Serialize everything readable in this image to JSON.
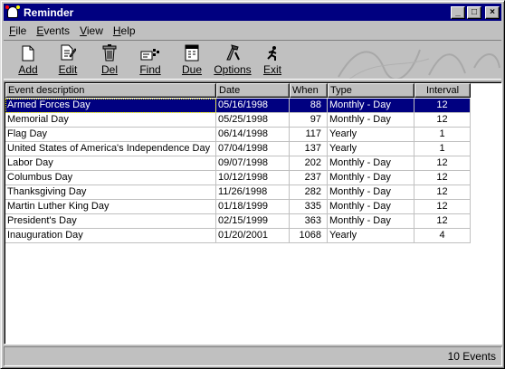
{
  "window": {
    "title": "Reminder",
    "controls": {
      "minimize": "_",
      "maximize": "□",
      "close": "×"
    }
  },
  "menu": [
    {
      "key": "F",
      "rest": "ile"
    },
    {
      "key": "E",
      "rest": "vents"
    },
    {
      "key": "V",
      "rest": "iew"
    },
    {
      "key": "H",
      "rest": "elp"
    }
  ],
  "toolbar": [
    {
      "label": "Add",
      "icon": "new-document-icon"
    },
    {
      "label": "Edit",
      "icon": "edit-document-icon"
    },
    {
      "label": "Del",
      "icon": "trash-can-icon"
    },
    {
      "label": "Find",
      "icon": "find-icon"
    },
    {
      "label": "Due",
      "icon": "calendar-icon"
    },
    {
      "label": "Options",
      "icon": "options-icon"
    },
    {
      "label": "Exit",
      "icon": "exit-runner-icon"
    }
  ],
  "columns": [
    "Event description",
    "Date",
    "When",
    "Type",
    "Interval"
  ],
  "rows": [
    {
      "desc": "Armed Forces Day",
      "date": "05/16/1998",
      "when": "88",
      "type": "Monthly - Day",
      "interval": "12"
    },
    {
      "desc": "Memorial Day",
      "date": "05/25/1998",
      "when": "97",
      "type": "Monthly - Day",
      "interval": "12"
    },
    {
      "desc": "Flag Day",
      "date": "06/14/1998",
      "when": "117",
      "type": "Yearly",
      "interval": "1"
    },
    {
      "desc": "United States of America's Independence Day",
      "date": "07/04/1998",
      "when": "137",
      "type": "Yearly",
      "interval": "1"
    },
    {
      "desc": "Labor Day",
      "date": "09/07/1998",
      "when": "202",
      "type": "Monthly - Day",
      "interval": "12"
    },
    {
      "desc": "Columbus Day",
      "date": "10/12/1998",
      "when": "237",
      "type": "Monthly - Day",
      "interval": "12"
    },
    {
      "desc": "Thanksgiving Day",
      "date": "11/26/1998",
      "when": "282",
      "type": "Monthly - Day",
      "interval": "12"
    },
    {
      "desc": "Martin Luther King Day",
      "date": "01/18/1999",
      "when": "335",
      "type": "Monthly - Day",
      "interval": "12"
    },
    {
      "desc": "President's Day",
      "date": "02/15/1999",
      "when": "363",
      "type": "Monthly - Day",
      "interval": "12"
    },
    {
      "desc": "Inauguration Day",
      "date": "01/20/2001",
      "when": "1068",
      "type": "Yearly",
      "interval": "4"
    }
  ],
  "selected_row": 0,
  "status": {
    "count_text": "10 Events"
  },
  "colors": {
    "title_bar": "#000080",
    "selection": "#000080",
    "face": "#c0c0c0"
  }
}
